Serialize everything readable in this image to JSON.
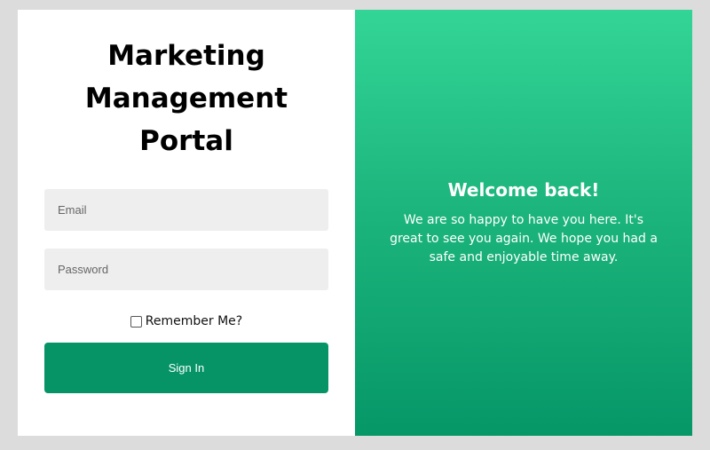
{
  "login": {
    "title": "Marketing Management Portal",
    "email_placeholder": "Email",
    "password_placeholder": "Password",
    "remember_label": "Remember Me?",
    "remember_checked": false,
    "signin_label": "Sign In"
  },
  "welcome": {
    "title": "Welcome back!",
    "text": "We are so happy to have you here. It's great to see you again. We hope you had a safe and enjoyable time away."
  },
  "colors": {
    "background": "#dcdcdc",
    "button": "#069466",
    "gradient_top": "#33d596",
    "gradient_bottom": "#069767"
  }
}
